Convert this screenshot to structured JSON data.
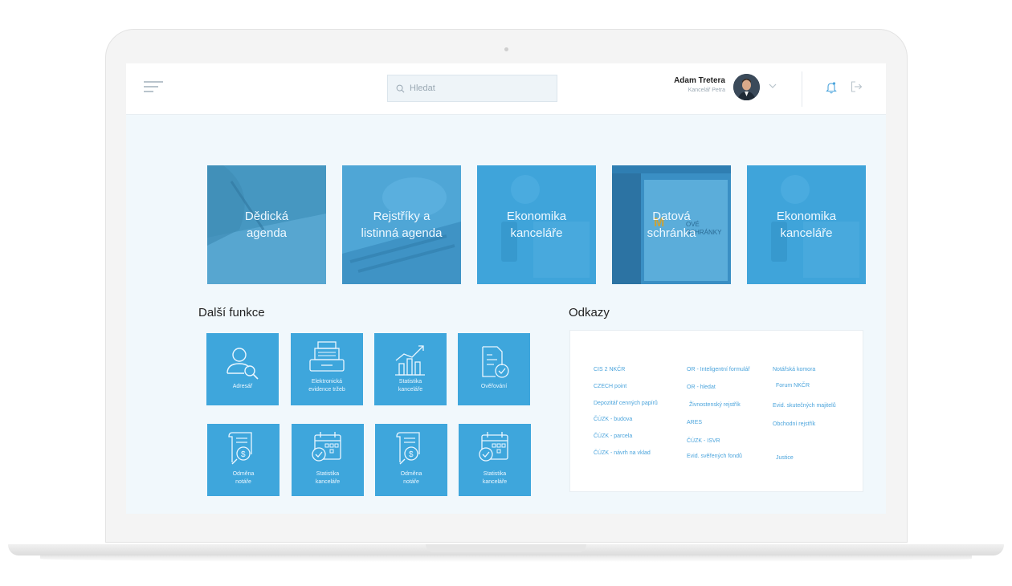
{
  "header": {
    "search_placeholder": "Hledat",
    "user_name": "Adam Tretera",
    "user_office": "Kancelář Petra"
  },
  "tiles": [
    {
      "label": "Dědická\nagenda"
    },
    {
      "label": "Rejstříky a\nlistinná agenda"
    },
    {
      "label": "Ekonomika\nkanceláře"
    },
    {
      "label": "Datová\nschránka",
      "badge": "OVÉ\nSCHRÁNKY"
    },
    {
      "label": "Ekonomika\nkanceláře"
    }
  ],
  "functions": {
    "title": "Další funkce",
    "items": [
      {
        "label": "Adresář",
        "icon": "user-search-icon"
      },
      {
        "label": "Elektronická\nevidence tržeb",
        "icon": "cash-register-icon"
      },
      {
        "label": "Statistika\nkanceláře",
        "icon": "bar-chart-icon"
      },
      {
        "label": "Ověřování",
        "icon": "document-check-icon"
      },
      {
        "label": "Odměna\nnotáře",
        "icon": "invoice-money-icon"
      },
      {
        "label": "Statistika\nkanceláře",
        "icon": "calendar-check-icon"
      },
      {
        "label": "Odměna\nnotáře",
        "icon": "invoice-money-icon"
      },
      {
        "label": "Statistika\nkanceláře",
        "icon": "calendar-check-icon"
      }
    ]
  },
  "links": {
    "title": "Odkazy",
    "col1": [
      "CIS 2 NKČR",
      "CZECH point",
      "Depozitář cenných papírů",
      "ČÚZK - budova",
      "ČÚZK - parcela",
      "ČÚZK - návrh na vklad"
    ],
    "col2": [
      "OR - Inteligentní formulář",
      "OR - hledat",
      "Živnostenský rejstřík",
      "ARES",
      "ČÚZK - ISVR",
      "Evid. svěřených fondů"
    ],
    "col3": [
      "Notářská komora",
      "Forum NKČR",
      "Evid. skutečných majitelů",
      "Obchodní rejstřík",
      "Justice"
    ]
  },
  "colors": {
    "tile": "#3ea6dc",
    "link": "#4ba4dc",
    "background": "#f1f8fc"
  }
}
